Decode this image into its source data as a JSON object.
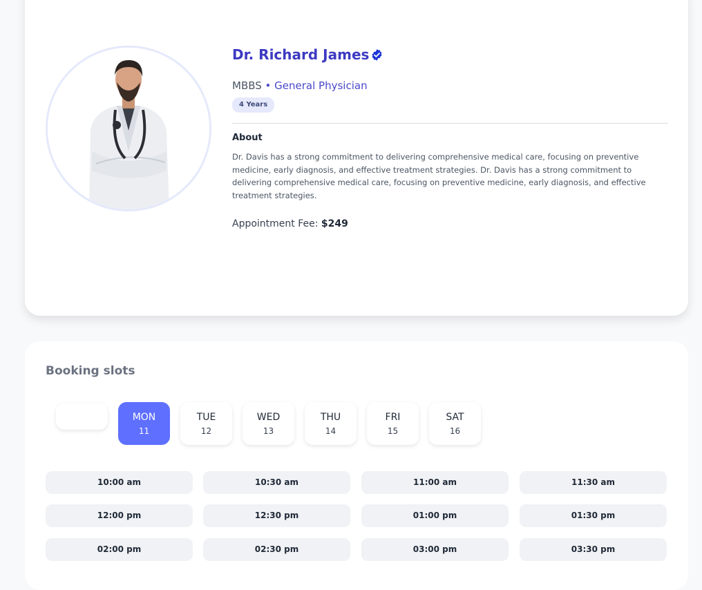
{
  "doctor": {
    "name": "Dr. Richard James",
    "degree": "MBBS",
    "separator": " • ",
    "speciality": "General Physician",
    "experience": "4 Years",
    "about_title": "About",
    "about_text": "Dr. Davis has a strong commitment to delivering comprehensive medical care, focusing on preventive medicine, early diagnosis, and effective treatment strategies. Dr. Davis has a strong commitment to delivering comprehensive medical care, focusing on preventive medicine, early diagnosis, and effective treatment strategies.",
    "fee_label": "Appointment Fee: ",
    "fee_value": "$249",
    "verified_icon": "verified-badge-icon"
  },
  "booking": {
    "title": "Booking slots",
    "days": [
      {
        "name": "",
        "num": ""
      },
      {
        "name": "MON",
        "num": "11"
      },
      {
        "name": "TUE",
        "num": "12"
      },
      {
        "name": "WED",
        "num": "13"
      },
      {
        "name": "THU",
        "num": "14"
      },
      {
        "name": "FRI",
        "num": "15"
      },
      {
        "name": "SAT",
        "num": "16"
      }
    ],
    "selected_day": "MON",
    "slots": [
      "10:00 am",
      "10:30 am",
      "11:00 am",
      "11:30 am",
      "12:00 pm",
      "12:30 pm",
      "01:00 pm",
      "01:30 pm",
      "02:00 pm",
      "02:30 pm",
      "03:00 pm",
      "03:30 pm"
    ]
  },
  "colors": {
    "accent": "#5f6fff",
    "name": "#3d3ac2",
    "verified": "#1d35d8",
    "badge_bg": "#e6e9fb",
    "slot_bg": "#f1f2f5"
  }
}
